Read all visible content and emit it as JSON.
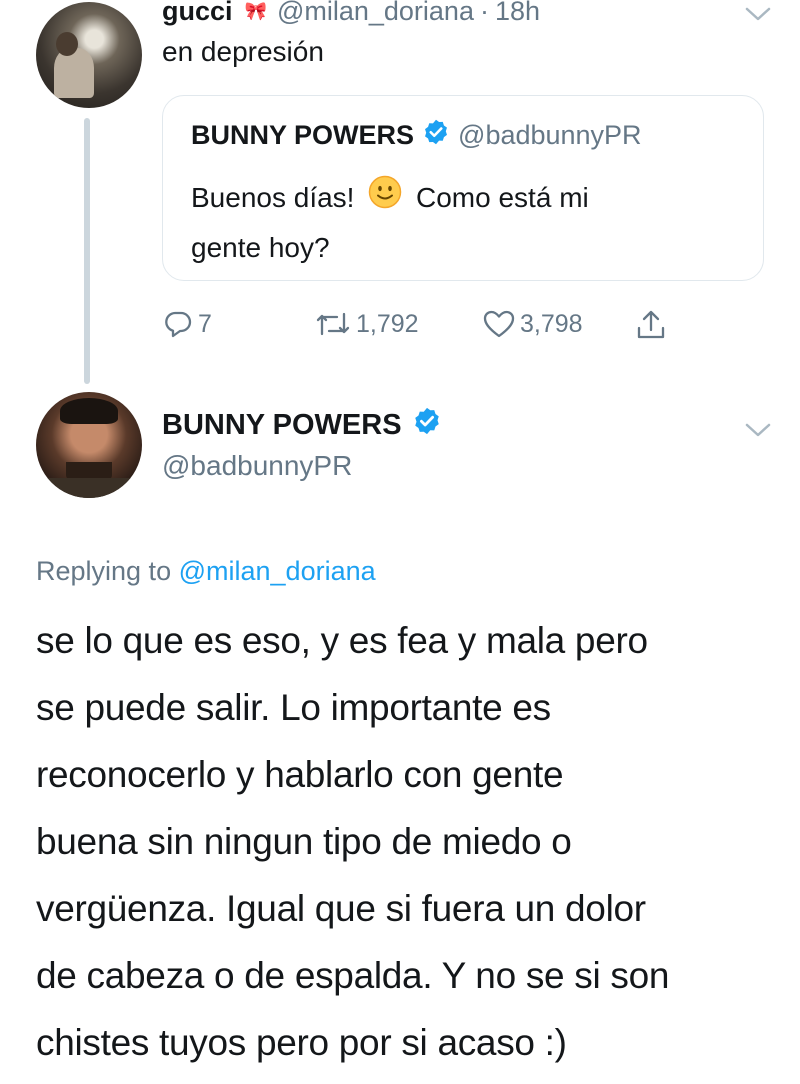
{
  "parent_tweet": {
    "display_name": "gucci",
    "handle": "@milan_doriana",
    "separator": "·",
    "time": "18h",
    "text": "en depresión",
    "quoted": {
      "display_name": "BUNNY POWERS",
      "handle": "@badbunnyPR",
      "text_line1_a": "Buenos días!",
      "text_line1_b": "Como está mi",
      "text_line2": "gente hoy?"
    },
    "actions": {
      "replies": "7",
      "retweets": "1,792",
      "likes": "3,798"
    }
  },
  "reply_tweet": {
    "display_name": "BUNNY POWERS",
    "handle": "@badbunnyPR",
    "replying_prefix": "Replying to",
    "replying_to": "@milan_doriana",
    "text_lines": [
      "se lo que es eso, y es fea y mala pero",
      "se puede salir. Lo importante es",
      "reconocerlo y hablarlo con gente",
      "buena sin ningun tipo de miedo o",
      "vergüenza. Igual que si fuera un dolor",
      "de cabeza o de espalda. Y no se si son",
      "chistes tuyos pero por si acaso :)"
    ]
  },
  "colors": {
    "verified": "#1da1f2",
    "muted": "#657786",
    "link": "#1da1f2",
    "border": "#e1e8ed",
    "thread_line": "#ccd6dd"
  }
}
